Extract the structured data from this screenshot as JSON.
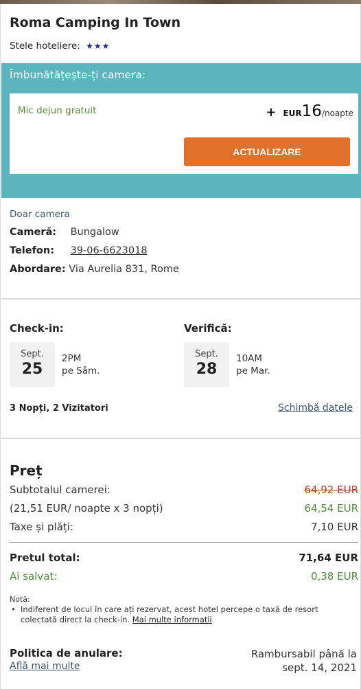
{
  "hotel": {
    "name": "Roma Camping In Town",
    "stars_label": "Stele hoteliere:",
    "stars": "★★★"
  },
  "upgrade": {
    "title": "Îmbunătățește-ți camera:",
    "perk": "Mic dejun gratuit",
    "plus": "+",
    "currency": "EUR",
    "amount": "16",
    "per": "/noapte",
    "button": "ACTUALIZARE"
  },
  "room": {
    "room_only": "Doar camera",
    "room_label": "Cameră:",
    "room_value": "Bungalow",
    "phone_label": "Telefon:",
    "phone_value": "39-06-6623018",
    "address_label": "Abordare:",
    "address_value": "Via Aurelia 831, Rome"
  },
  "checkin": {
    "title": "Check-in:",
    "month": "Sept.",
    "day": "25",
    "time": "2PM",
    "weekday": "pe Sâm."
  },
  "checkout": {
    "title": "Verifică:",
    "month": "Sept.",
    "day": "28",
    "time": "10AM",
    "weekday": "pe Mar."
  },
  "stay": {
    "guests": "3 Nopți, 2 Vizitatori",
    "change_dates": "Schimbă datele"
  },
  "price": {
    "title": "Preț",
    "subtotal_label": "Subtotalul camerei:",
    "subtotal_old": "64,92 EUR",
    "per_night_label": "(21,51 EUR/ noapte x 3 nopți)",
    "subtotal_new": "64,54 EUR",
    "taxes_label": "Taxe și plăți:",
    "taxes_value": "7,10 EUR",
    "total_label": "Pretul total:",
    "total_value": "71,64 EUR",
    "saved_label": "Ai salvat:",
    "saved_value": "0,38 EUR"
  },
  "note": {
    "label": "Notă:",
    "text": "Indiferent de locul în care ați rezervat, acest hotel percepe o taxă de resort colectată direct la check-in.",
    "link": "Mai multe informatii"
  },
  "cancellation": {
    "label": "Politica de anulare:",
    "learn_more": "Află mai multe",
    "refund_line1": "Rambursabil până la",
    "refund_line2": "sept. 14, 2021"
  }
}
